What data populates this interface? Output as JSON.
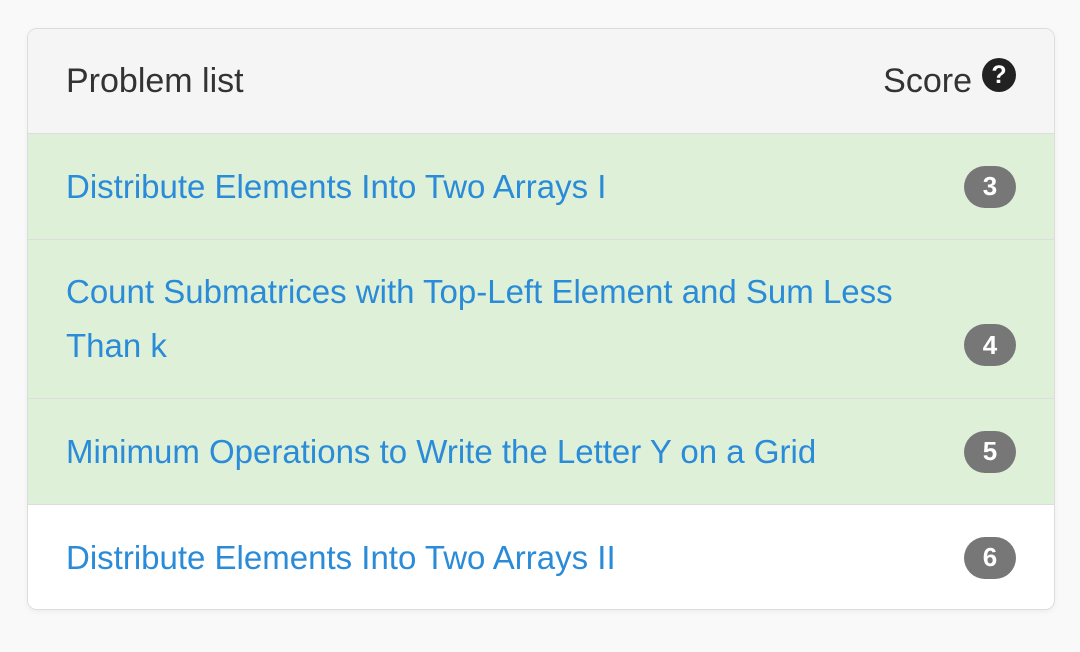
{
  "header": {
    "title": "Problem list",
    "score_label": "Score",
    "help_icon": "question-circle-icon",
    "help_glyph": "?"
  },
  "problems": [
    {
      "title": "Distribute Elements Into Two Arrays I",
      "score": "3",
      "solved": true
    },
    {
      "title": "Count Submatrices with Top-Left Element and Sum Less Than k",
      "score": "4",
      "solved": true
    },
    {
      "title": "Minimum Operations to Write the Letter Y on a Grid",
      "score": "5",
      "solved": true
    },
    {
      "title": "Distribute Elements Into Two Arrays II",
      "score": "6",
      "solved": false
    }
  ],
  "colors": {
    "solved_row_bg": "#dff0d8",
    "link": "#2a8bd8",
    "badge_bg": "#777777",
    "header_bg": "#f5f5f5"
  }
}
